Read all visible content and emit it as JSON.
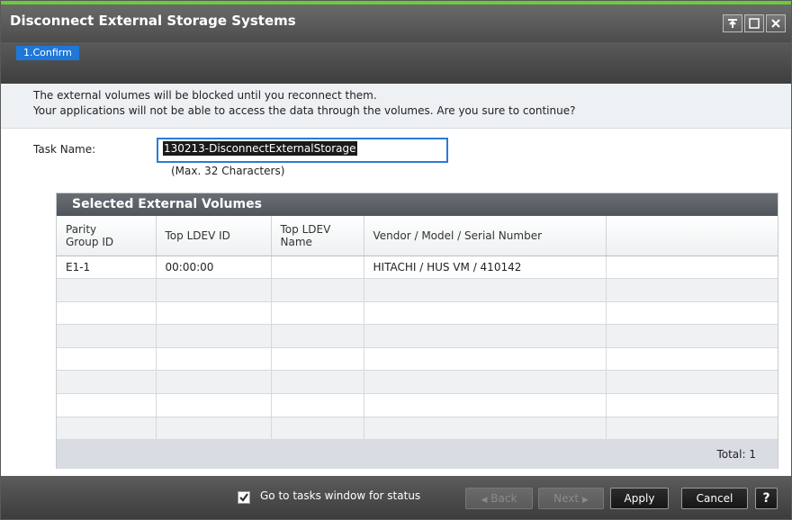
{
  "window": {
    "title": "Disconnect External Storage Systems",
    "controls": [
      "pin-icon",
      "maximize-icon",
      "close-icon"
    ],
    "accent_color": "#6ac93c"
  },
  "wizard": {
    "step": "1.Confirm",
    "step_color": "#1f77d8"
  },
  "info": {
    "line1": "The external volumes will be blocked until you reconnect them.",
    "line2": "Your applications will not be able to access the data through the volumes. Are you sure to continue?"
  },
  "task": {
    "label": "Task Name:",
    "value": "130213-DisconnectExternalStorage",
    "hint": "(Max. 32 Characters)"
  },
  "table": {
    "title": "Selected External Volumes",
    "headers": {
      "parity": "Parity\nGroup ID",
      "top_ldev_id": "Top LDEV ID",
      "top_ldev_name": "Top LDEV\nName",
      "vendor": "Vendor / Model / Serial Number"
    },
    "rows": [
      {
        "parity": "E1-1",
        "top_ldev_id": "00:00:00",
        "top_ldev_name": "",
        "vendor": "HITACHI / HUS VM / 410142"
      }
    ],
    "total": "Total:  1"
  },
  "footer": {
    "checkbox_label": "Go to tasks window for status",
    "checkbox_checked": true,
    "back": "Back",
    "next": "Next",
    "apply": "Apply",
    "cancel": "Cancel",
    "help": "?"
  }
}
